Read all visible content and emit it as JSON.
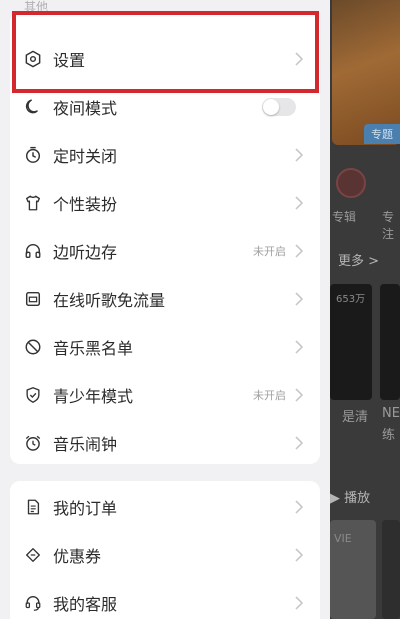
{
  "section_title": "其他",
  "menu_group_1": [
    {
      "label": "设置",
      "icon": "hexagon-settings-icon"
    },
    {
      "label": "夜间模式",
      "icon": "moon-icon",
      "toggle": false
    },
    {
      "label": "定时关闭",
      "icon": "timer-icon"
    },
    {
      "label": "个性装扮",
      "icon": "tshirt-icon"
    },
    {
      "label": "边听边存",
      "icon": "headphones-icon",
      "status": "未开启"
    },
    {
      "label": "在线听歌免流量",
      "icon": "data-card-icon"
    },
    {
      "label": "音乐黑名单",
      "icon": "block-icon"
    },
    {
      "label": "青少年模式",
      "icon": "shield-check-icon",
      "status": "未开启"
    },
    {
      "label": "音乐闹钟",
      "icon": "alarm-clock-icon"
    }
  ],
  "menu_group_2": [
    {
      "label": "我的订单",
      "icon": "order-doc-icon"
    },
    {
      "label": "优惠券",
      "icon": "coupon-icon"
    },
    {
      "label": "我的客服",
      "icon": "headset-icon"
    }
  ],
  "background": {
    "banner_badge": "专题",
    "circle_labels": [
      "专辑",
      "专注"
    ],
    "more_label": "更多 >",
    "card_count": "653万",
    "card_text_1": "是清",
    "card_text_2": "NE",
    "card_text_3": "练",
    "play_label": "▶ 播放",
    "vie_text": "VIE"
  },
  "colors": {
    "highlight": "#d3282e",
    "drawer_bg": "#f1f1f3",
    "card_bg": "#ffffff"
  }
}
